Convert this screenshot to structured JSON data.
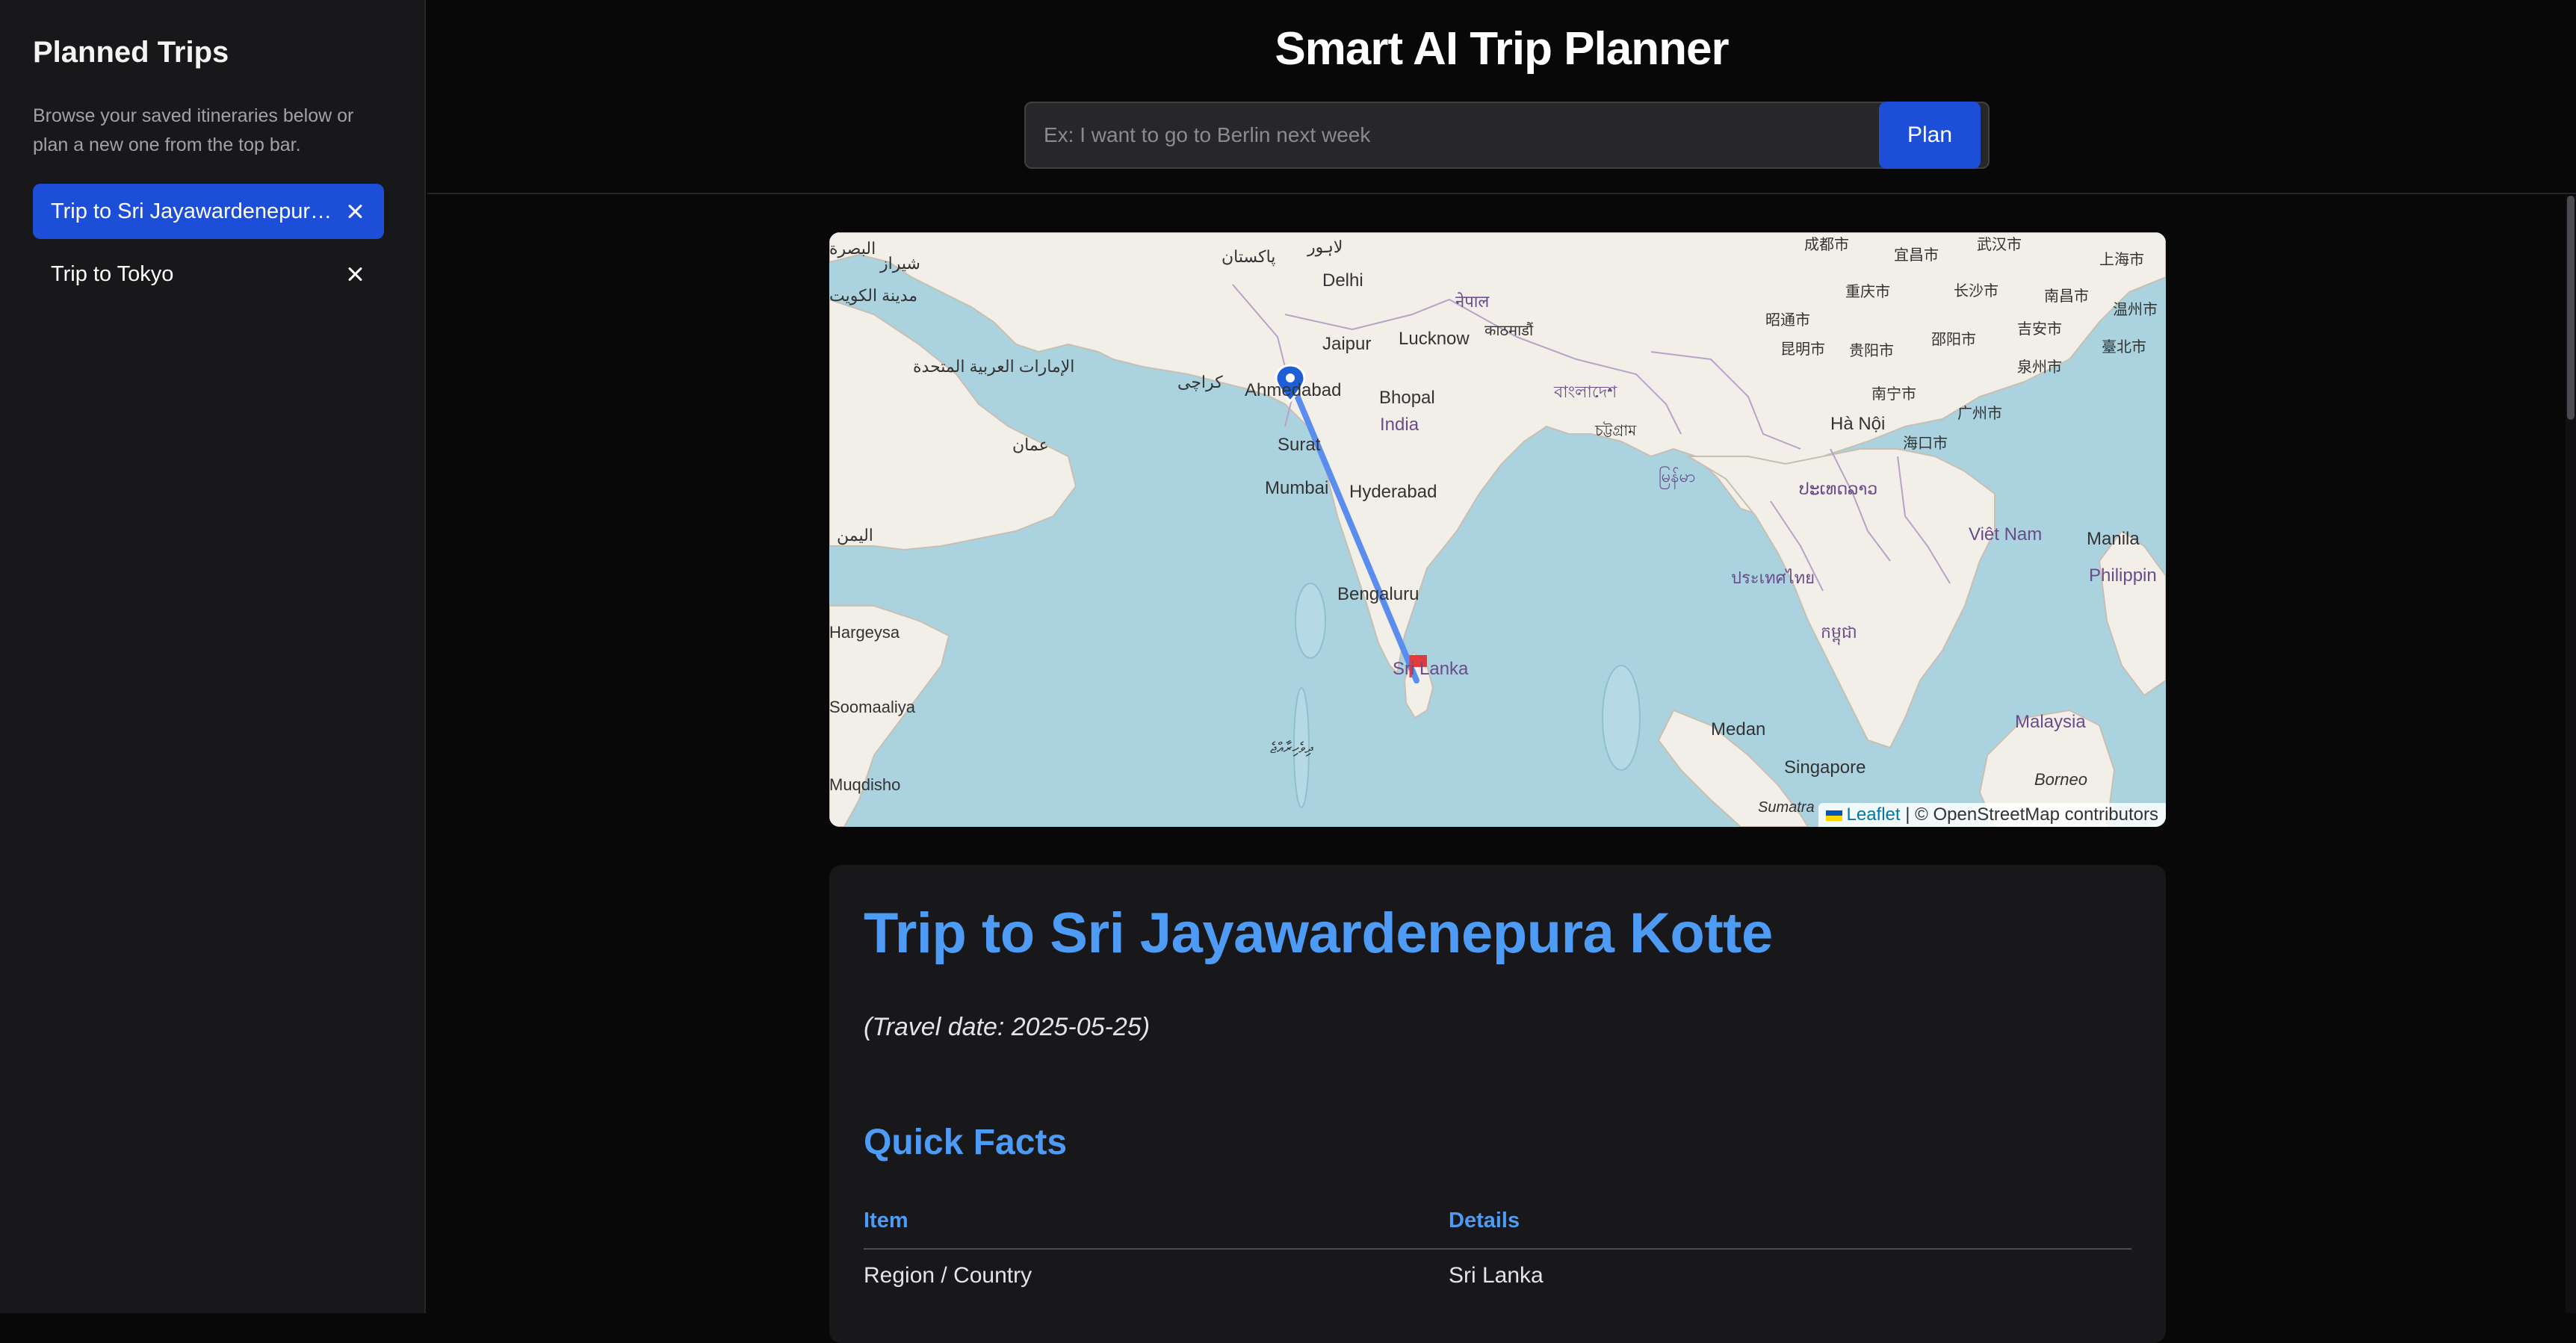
{
  "sidebar": {
    "title": "Planned Trips",
    "description": "Browse your saved itineraries below or plan a new one from the top bar.",
    "trips": [
      {
        "label": "Trip to Sri Jayawardenepura Kotte",
        "active": true
      },
      {
        "label": "Trip to Tokyo",
        "active": false
      }
    ]
  },
  "header": {
    "title": "Smart AI Trip Planner",
    "search_placeholder": "Ex: I want to go to Berlin next week",
    "plan_label": "Plan"
  },
  "map": {
    "origin": "Ahmedabad",
    "destination": "Sri Lanka",
    "labels": {
      "delhi": "Delhi",
      "jaipur": "Jaipur",
      "lucknow": "Lucknow",
      "ahmedabad": "Ahmedabad",
      "bhopal": "Bhopal",
      "india": "India",
      "surat": "Surat",
      "mumbai": "Mumbai",
      "hyderabad": "Hyderabad",
      "bengaluru": "Bengaluru",
      "sri_lanka": "Sri Lanka",
      "medan": "Medan",
      "singapore": "Singapore",
      "malaysia": "Malaysia",
      "borneo": "Borneo",
      "manila": "Manila",
      "philippines": "Philippin",
      "viet_nam": "Viêt Nam",
      "ha_noi": "Hà Nội",
      "sumatra": "Sumatra",
      "pakistan": "پاکستان",
      "lahore": "لاہور",
      "karachi": "کراچی",
      "oman": "عمان",
      "uae": "الإمارات العربية المتحدة",
      "yemen": "اليمن",
      "kuwait": "مدينة الكويت",
      "basra": "البصرة",
      "shiraz": "شیراز",
      "nepal": "नेपाल",
      "kathmandu": "काठमाडौं",
      "bangladesh": "বাংলাদেশ",
      "chattogram": "চট্টগ্রাম",
      "myanmar": "မြန်မာ",
      "thailand": "ประเทศไทย",
      "cambodia": "កម្ពុជា",
      "laos": "ປະເທດລາວ",
      "chengdu": "成都市",
      "yichang": "宜昌市",
      "wuhan": "武汉市",
      "shanghai": "上海市",
      "chongqing": "重庆市",
      "changsha": "长沙市",
      "nanchang": "南昌市",
      "wenzhou": "温州市",
      "zhaotong": "昭通市",
      "guiyang": "贵阳市",
      "shaoyang": "邵阳市",
      "jian": "吉安市",
      "kunming": "昆明市",
      "quanzhou": "泉州市",
      "taipei": "臺北市",
      "nanning": "南宁市",
      "guangzhou": "广州市",
      "haikou": "海口市",
      "hargeysa": "Hargeysa",
      "somaliya": "Soomaaliya",
      "maldives": "ދިވެހިރާއްޖެ",
      "mogadishu": "Muqdisho"
    },
    "attribution_link": "Leaflet",
    "attribution_text": "| © OpenStreetMap contributors"
  },
  "content": {
    "title": "Trip to Sri Jayawardenepura Kotte",
    "travel_date": "(Travel date: 2025-05-25)",
    "quick_facts_heading": "Quick Facts",
    "table": {
      "headers": [
        "Item",
        "Details"
      ],
      "rows": [
        [
          "Region / Country",
          "Sri Lanka"
        ]
      ]
    }
  },
  "colors": {
    "accent": "#1d4ed8",
    "heading": "#4e9bf5",
    "route": "#5b8def",
    "origin_marker": "#1e5fd6",
    "destination_flag": "#e03c3c"
  }
}
